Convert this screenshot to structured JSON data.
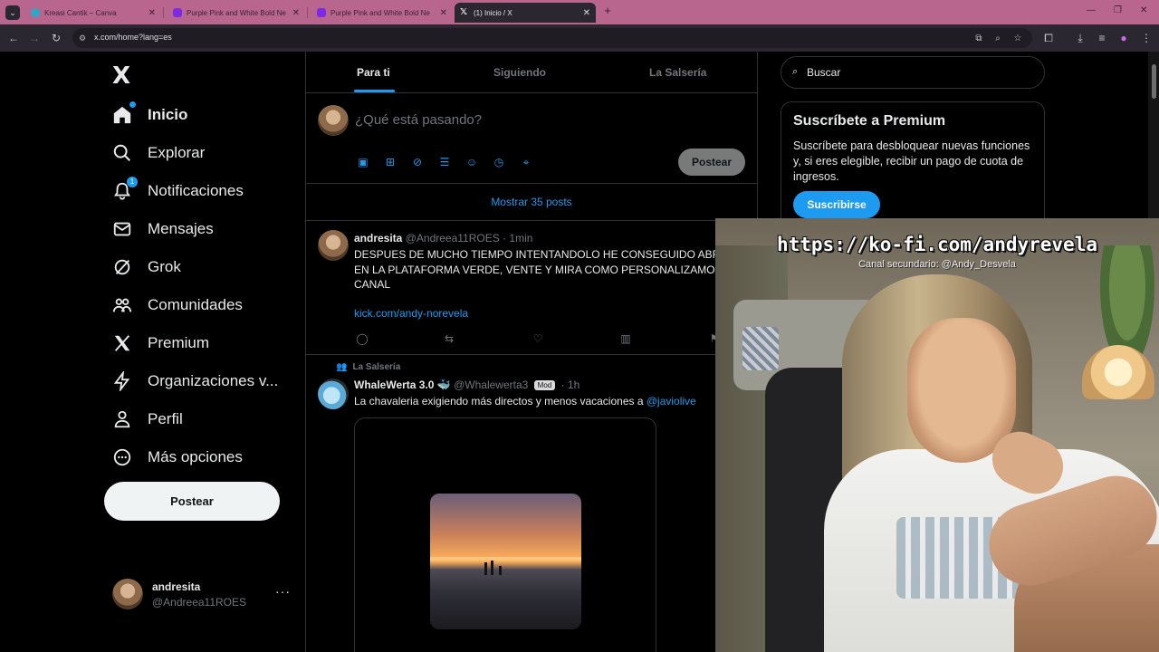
{
  "browser": {
    "tabs": [
      {
        "label": "Kreasi Cantik – Canva",
        "favicon_color": "#2aa7c9"
      },
      {
        "label": "Purple Pink and White Bold Ne",
        "favicon_color": "#7d2ae8"
      },
      {
        "label": "Purple Pink and White Bold Ne",
        "favicon_color": "#7d2ae8"
      },
      {
        "label": "(1) Inicio / X",
        "favicon_color": "#000000"
      }
    ],
    "url": "x.com/home?lang=es",
    "accent_color": "#b9668f"
  },
  "sidebar": {
    "logo": "X",
    "nav": [
      {
        "label": "Inicio",
        "icon": "home-icon"
      },
      {
        "label": "Explorar",
        "icon": "search-icon"
      },
      {
        "label": "Notificaciones",
        "icon": "bell-icon",
        "badge": "1"
      },
      {
        "label": "Mensajes",
        "icon": "mail-icon"
      },
      {
        "label": "Grok",
        "icon": "grok-icon"
      },
      {
        "label": "Comunidades",
        "icon": "people-icon"
      },
      {
        "label": "Premium",
        "icon": "x-logo-icon"
      },
      {
        "label": "Organizaciones v...",
        "icon": "lightning-icon"
      },
      {
        "label": "Perfil",
        "icon": "person-icon"
      },
      {
        "label": "Más opciones",
        "icon": "more-circle-icon"
      }
    ],
    "post_button": "Postear",
    "account": {
      "name": "andresita",
      "handle": "@Andreea11ROES",
      "more": "···"
    }
  },
  "feed": {
    "tabs": [
      "Para ti",
      "Siguiendo",
      "La Salsería"
    ],
    "compose": {
      "placeholder": "¿Qué está pasando?",
      "post_button": "Postear"
    },
    "show_posts": "Mostrar 35 posts",
    "tweets": [
      {
        "name": "andresita",
        "handle": "@Andreea11ROES",
        "time": "1min",
        "lines": [
          "DESPUES DE MUCHO TIEMPO INTENTANDOLO HE CONSEGUIDO ABRIR",
          "EN LA PLATAFORMA VERDE, VENTE Y MIRA COMO PERSONALIZAMOS EL",
          "CANAL"
        ],
        "link": "kick.com/andy-norevela"
      },
      {
        "social_context": "La Salsería",
        "name": "WhaleWerta 3.0 🐳",
        "handle": "@Whalewerta3",
        "mod_badge": "Mod",
        "time": "1h",
        "text": "La chavaleria exigiendo más directos y menos vacaciones a ",
        "mention": "@javiolive"
      }
    ]
  },
  "right": {
    "search_placeholder": "Buscar",
    "premium": {
      "title": "Suscríbete a Premium",
      "description": "Suscríbete para desbloquear nuevas funciones y, si eres elegible, recibir un pago de cuota de ingresos.",
      "button": "Suscribirse"
    }
  },
  "webcam": {
    "overlay_url": "https://ko-fi.com/andyrevela",
    "overlay_sub": "Canal secundario: @Andy_Desvela"
  }
}
